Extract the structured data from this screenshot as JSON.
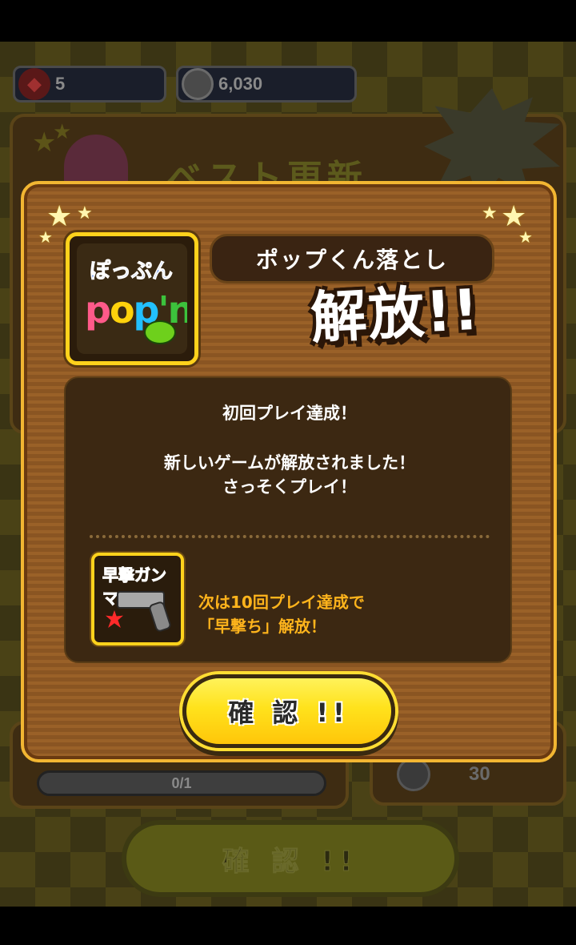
{
  "status_bar": {
    "gems": "5",
    "coins": "6,030"
  },
  "background_screen": {
    "title": "ベスト更新",
    "progress_text": "0/1",
    "reward_coins": "30",
    "confirm_label": "確 認 !!"
  },
  "modal": {
    "game_title": "ポップくん落とし",
    "unlock_text": "解放!!",
    "game_icon": {
      "top_text": "ぽっぷん",
      "logo_text": "pop'n"
    },
    "message": {
      "line1": "初回プレイ達成！",
      "line2": "新しいゲームが解放されました！",
      "line3": "さっそくプレイ！"
    },
    "next_unlock": {
      "icon_text": "早撃ガンマン",
      "line1": "次は10回プレイ達成で",
      "line2": "「早撃ち」解放！"
    },
    "confirm_label": "確 認 !!"
  },
  "colors": {
    "accent_yellow": "#ffd21c",
    "modal_wood": "#8b5524",
    "next_text": "#ffb41c"
  }
}
